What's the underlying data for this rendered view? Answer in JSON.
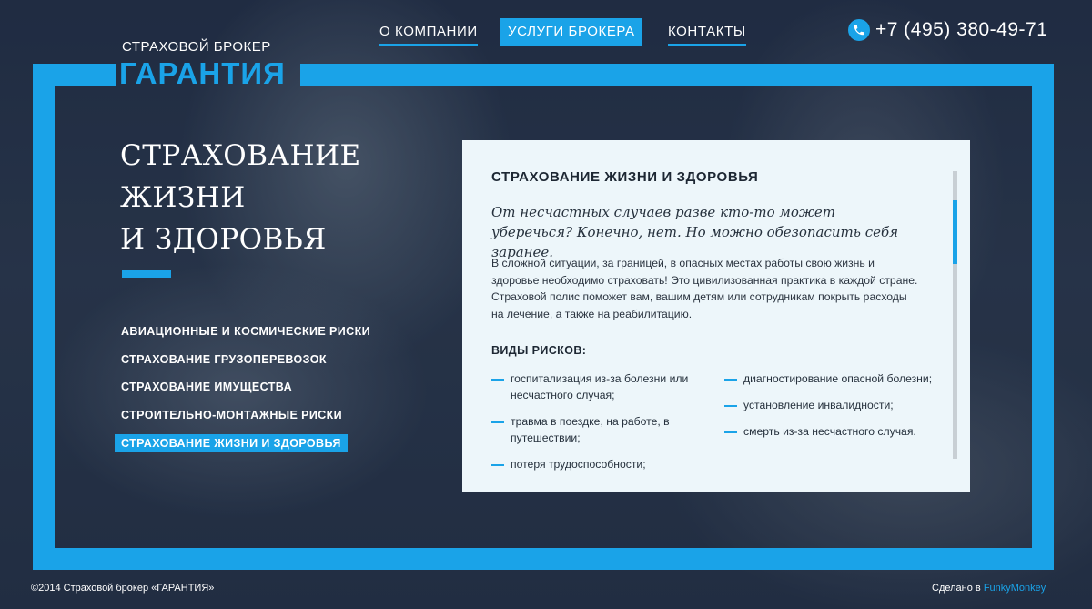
{
  "colors": {
    "accent": "#1aa3e8",
    "card_bg": "#edf6fa",
    "text_dark": "#1d2733"
  },
  "logo": {
    "subtitle": "СТРАХОВОЙ БРОКЕР",
    "name": "ГАРАНТИЯ"
  },
  "nav": {
    "items": [
      {
        "label": "О КОМПАНИИ",
        "state": "underline"
      },
      {
        "label": "УСЛУГИ БРОКЕРА",
        "state": "active"
      },
      {
        "label": "КОНТАКТЫ",
        "state": "underline"
      }
    ]
  },
  "phone": {
    "icon": "phone-icon",
    "number": "+7 (495) 380-49-71"
  },
  "hero": {
    "title_lines": [
      "СТРАХОВАНИЕ",
      "ЖИЗНИ",
      "И ЗДОРОВЬЯ"
    ]
  },
  "side_menu": {
    "items": [
      {
        "label": "АВИАЦИОННЫЕ И КОСМИЧЕСКИЕ РИСКИ",
        "active": false
      },
      {
        "label": "СТРАХОВАНИЕ ГРУЗОПЕРЕВОЗОК",
        "active": false
      },
      {
        "label": "СТРАХОВАНИЕ ИМУЩЕСТВА",
        "active": false
      },
      {
        "label": "СТРОИТЕЛЬНО-МОНТАЖНЫЕ РИСКИ",
        "active": false
      },
      {
        "label": "СТРАХОВАНИЕ ЖИЗНИ И ЗДОРОВЬЯ",
        "active": true
      }
    ]
  },
  "card": {
    "title": "СТРАХОВАНИЕ ЖИЗНИ И ЗДОРОВЬЯ",
    "quote": "От несчастных случаев разве кто-то может уберечься? Конечно, нет. Но можно обезопасить себя заранее.",
    "body": "В сложной ситуации, за границей, в опасных местах работы свою жизнь и здоровье необходимо страховать! Это цивилизованная практика в каждой стране. Страховой полис поможет вам, вашим детям или сотрудникам покрыть расходы на лечение, а также на реабилитацию.",
    "risks_title": "ВИДЫ РИСКОВ:",
    "risks_left": [
      "госпитализация из-за болезни или несчастного случая;",
      "травма в поездке, на работе, в путешествии;",
      "потеря трудоспособности;"
    ],
    "risks_right": [
      "диагностирование опасной болезни;",
      "установление инвалидности;",
      "смерть из-за несчастного случая."
    ]
  },
  "footer": {
    "copyright": "©2014 Страховой брокер «ГАРАНТИЯ»",
    "made_by_prefix": "Сделано в",
    "made_by_brand": "FunkyMonkey"
  }
}
